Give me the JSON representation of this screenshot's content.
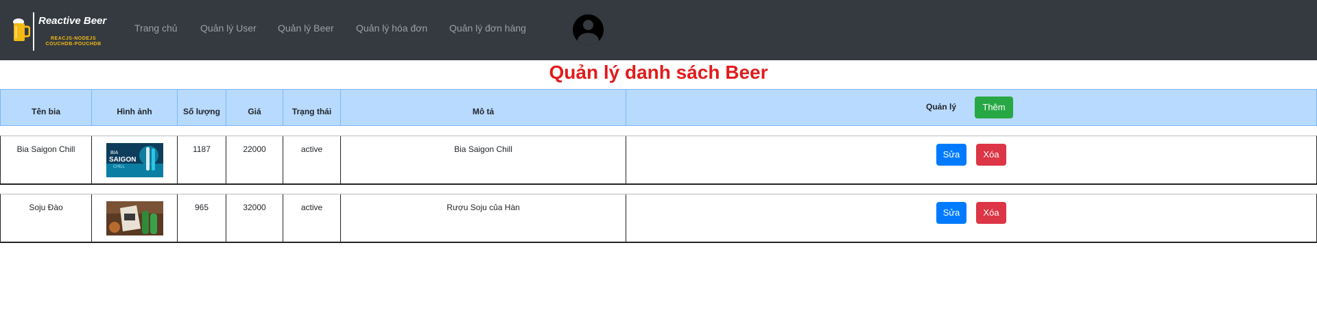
{
  "app": {
    "logo_title": "Reactive Beer",
    "logo_sub1": "REACJS-NODEJS",
    "logo_sub2": "COUCHDB-POUCHDB"
  },
  "nav": {
    "items": [
      {
        "label": "Trang chủ"
      },
      {
        "label": "Quản lý User"
      },
      {
        "label": "Quản lý Beer"
      },
      {
        "label": "Quản lý hóa đơn"
      },
      {
        "label": "Quản lý đơn hàng"
      }
    ]
  },
  "page": {
    "title": "Quản lý danh sách Beer"
  },
  "table": {
    "headers": {
      "name": "Tên bia",
      "image": "Hình ảnh",
      "quantity": "Số lượng",
      "price": "Giá",
      "status": "Trạng thái",
      "description": "Mô tả",
      "manage": "Quản lý"
    },
    "add_label": "Thêm",
    "edit_label": "Sửa",
    "delete_label": "Xóa",
    "rows": [
      {
        "name": "Bia Saigon Chill",
        "image": "bia-saigon-chill-image",
        "quantity": "1187",
        "price": "22000",
        "status": "active",
        "description": "Bia Saigon Chill"
      },
      {
        "name": "Soju Đào",
        "image": "soju-dao-image",
        "quantity": "965",
        "price": "32000",
        "status": "active",
        "description": "Rượu Soju của Hàn"
      }
    ]
  },
  "colors": {
    "navbar": "#343a40",
    "title": "#e31b1b",
    "header_bg": "#b8daff",
    "edit": "#007bff",
    "delete": "#dc3545",
    "add": "#28a745"
  }
}
